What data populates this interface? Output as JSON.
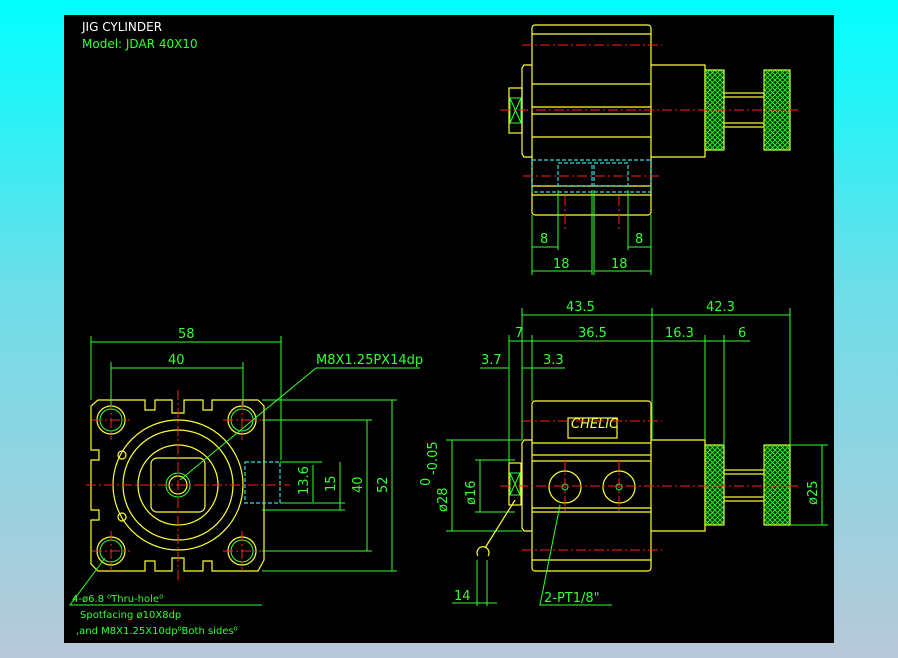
{
  "title": "JIG CYLINDER",
  "model": "Model:  JDAR  40X10",
  "colors": {
    "background_top": "#00ffff",
    "background_bottom": "#b8c8d8",
    "canvas": "#000000",
    "outline": "#ffff33",
    "dimension": "#33ff33",
    "centerline": "#ff2020",
    "hidden": "#33dddd"
  },
  "front_view": {
    "dims": {
      "width_58": "58",
      "pitch_40": "40",
      "h_13_6": "13.6",
      "h_15": "15",
      "h_40": "40",
      "h_52": "52"
    },
    "thread_callout": "M8X1.25PX14dp",
    "hole_notes": [
      "4-ø6.8 ⁰Thru-hole⁰",
      "Spotfacing  ø10X8dp",
      ",and M8X1.25X10dp⁰Both sides⁰"
    ]
  },
  "top_view": {
    "dims": {
      "left_8": "8",
      "right_8": "8",
      "left_18": "18",
      "right_18": "18"
    }
  },
  "side_view": {
    "dims": {
      "d43_5": "43.5",
      "d42_3": "42.3",
      "d7": "7",
      "d36_5": "36.5",
      "d16_3": "16.3",
      "d6": "6",
      "d3_7": "3.7",
      "d3_3": "3.3",
      "dia25": "ø25",
      "dia16": "ø16",
      "dia28": "ø28",
      "dia28_tol": "-0.05",
      "dia28_tol_upper": "0",
      "d14": "14"
    },
    "port_callout": "2-PT1/8\"",
    "label_brand": "CHELIC"
  }
}
